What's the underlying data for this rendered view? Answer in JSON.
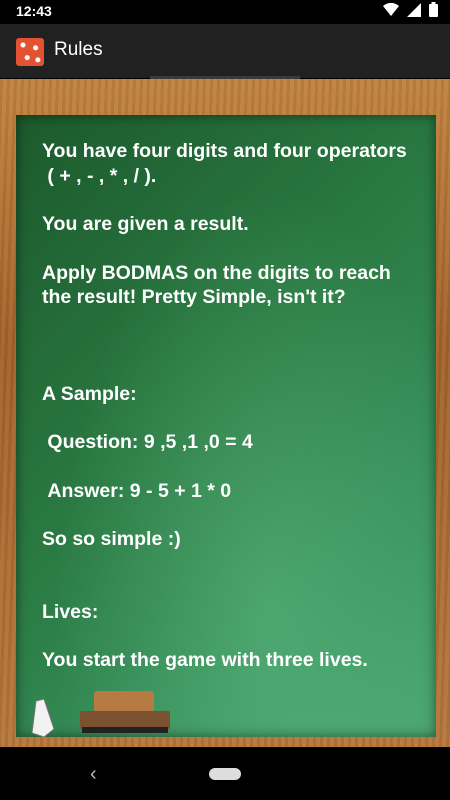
{
  "status_bar": {
    "time": "12:43"
  },
  "app_bar": {
    "title": "Rules"
  },
  "rules": {
    "paragraphs": [
      "You have four digits and four operators\n ( + , - , * , / ).",
      "You are given a result.",
      "Apply BODMAS on the digits to reach the result! Pretty Simple, isn't it?",
      "A Sample:",
      " Question: 9 ,5 ,1 ,0 = 4",
      " Answer: 9 - 5 + 1 * 0",
      "So so simple :)",
      "Lives:",
      "You start the game with three lives."
    ]
  },
  "colors": {
    "board_green": "#2a7a43",
    "frame_wood": "#b7773a",
    "app_bar": "#212121",
    "text": "#ffffff"
  },
  "icons": {
    "app_icon": "dice-app-icon",
    "wifi": "wifi-icon",
    "signal": "cell-signal-icon",
    "battery": "battery-icon",
    "back": "back-icon",
    "home": "home-pill-icon"
  }
}
